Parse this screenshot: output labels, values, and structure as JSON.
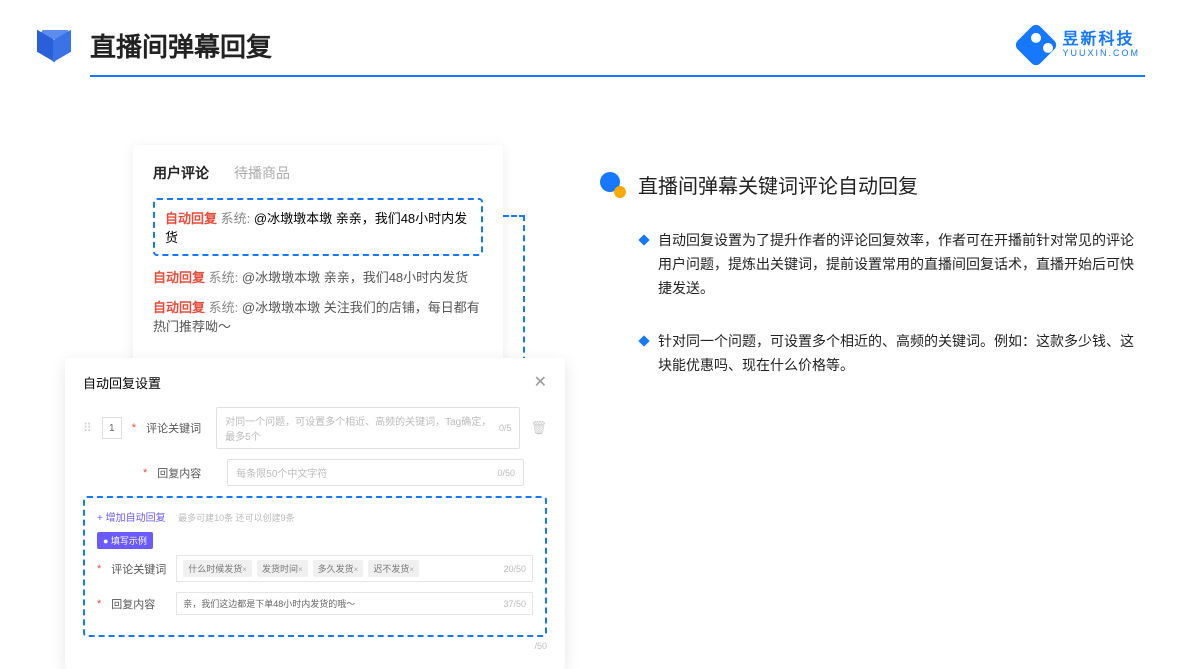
{
  "header": {
    "title": "直播间弹幕回复",
    "logo_cn": "昱新科技",
    "logo_en": "YUUXIN.COM"
  },
  "card1": {
    "tab_active": "用户评论",
    "tab_inactive": "待播商品",
    "line1_tag": "自动回复",
    "line1_sys": "系统:",
    "line1_text": "@冰墩墩本墩 亲亲，我们48小时内发货",
    "line2_tag": "自动回复",
    "line2_sys": "系统:",
    "line2_text": "@冰墩墩本墩 亲亲，我们48小时内发货",
    "line3_tag": "自动回复",
    "line3_sys": "系统:",
    "line3_text": "@冰墩墩本墩 关注我们的店铺，每日都有热门推荐呦～"
  },
  "card2": {
    "title": "自动回复设置",
    "row_num": "1",
    "label_keyword": "评论关键词",
    "placeholder_keyword": "对同一个问题，可设置多个相近、高频的关键词，Tag确定，最多5个",
    "count_keyword": "0/5",
    "label_content": "回复内容",
    "placeholder_content": "每条限50个中文字符",
    "count_content": "0/50",
    "add_link": "+ 增加自动回复",
    "add_hint": "最多可建10条 还可以创建9条",
    "example_badge": "● 填写示例",
    "ex_label_keyword": "评论关键词",
    "ex_tags": [
      "什么时候发货",
      "发货时间",
      "多久发货",
      "迟不发货"
    ],
    "ex_count_keyword": "20/50",
    "ex_label_content": "回复内容",
    "ex_content": "亲，我们这边都是下单48小时内发货的哦～",
    "ex_count_content": "37/50",
    "outer_count": "/50"
  },
  "right": {
    "section_title": "直播间弹幕关键词评论自动回复",
    "bullet1": "自动回复设置为了提升作者的评论回复效率，作者可在开播前针对常见的评论用户问题，提炼出关键词，提前设置常用的直播间回复话术，直播开始后可快捷发送。",
    "bullet2": "针对同一个问题，可设置多个相近的、高频的关键词。例如：这款多少钱、这块能优惠吗、现在什么价格等。"
  }
}
